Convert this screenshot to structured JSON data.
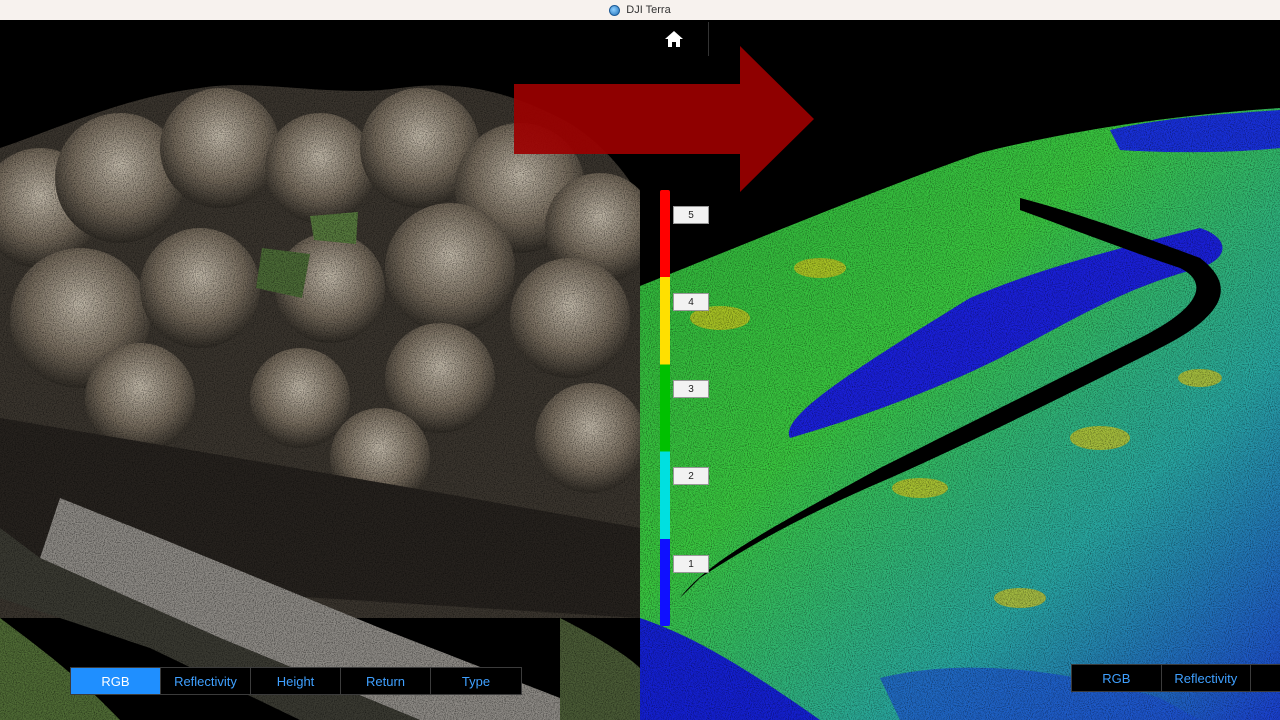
{
  "window": {
    "title": "DJI Terra"
  },
  "toolbar": {
    "home_icon": "home-icon"
  },
  "legend": {
    "ticks": [
      "5",
      "4",
      "3",
      "2",
      "1"
    ]
  },
  "left_view": {
    "mode_buttons": [
      "RGB",
      "Reflectivity",
      "Height",
      "Return",
      "Type"
    ],
    "active_mode": "RGB"
  },
  "right_view": {
    "mode_buttons": [
      "RGB",
      "Reflectivity"
    ]
  },
  "colors": {
    "active_button": "#1f8fff",
    "button_text": "#3fa0ff",
    "arrow": "#9b0000"
  }
}
